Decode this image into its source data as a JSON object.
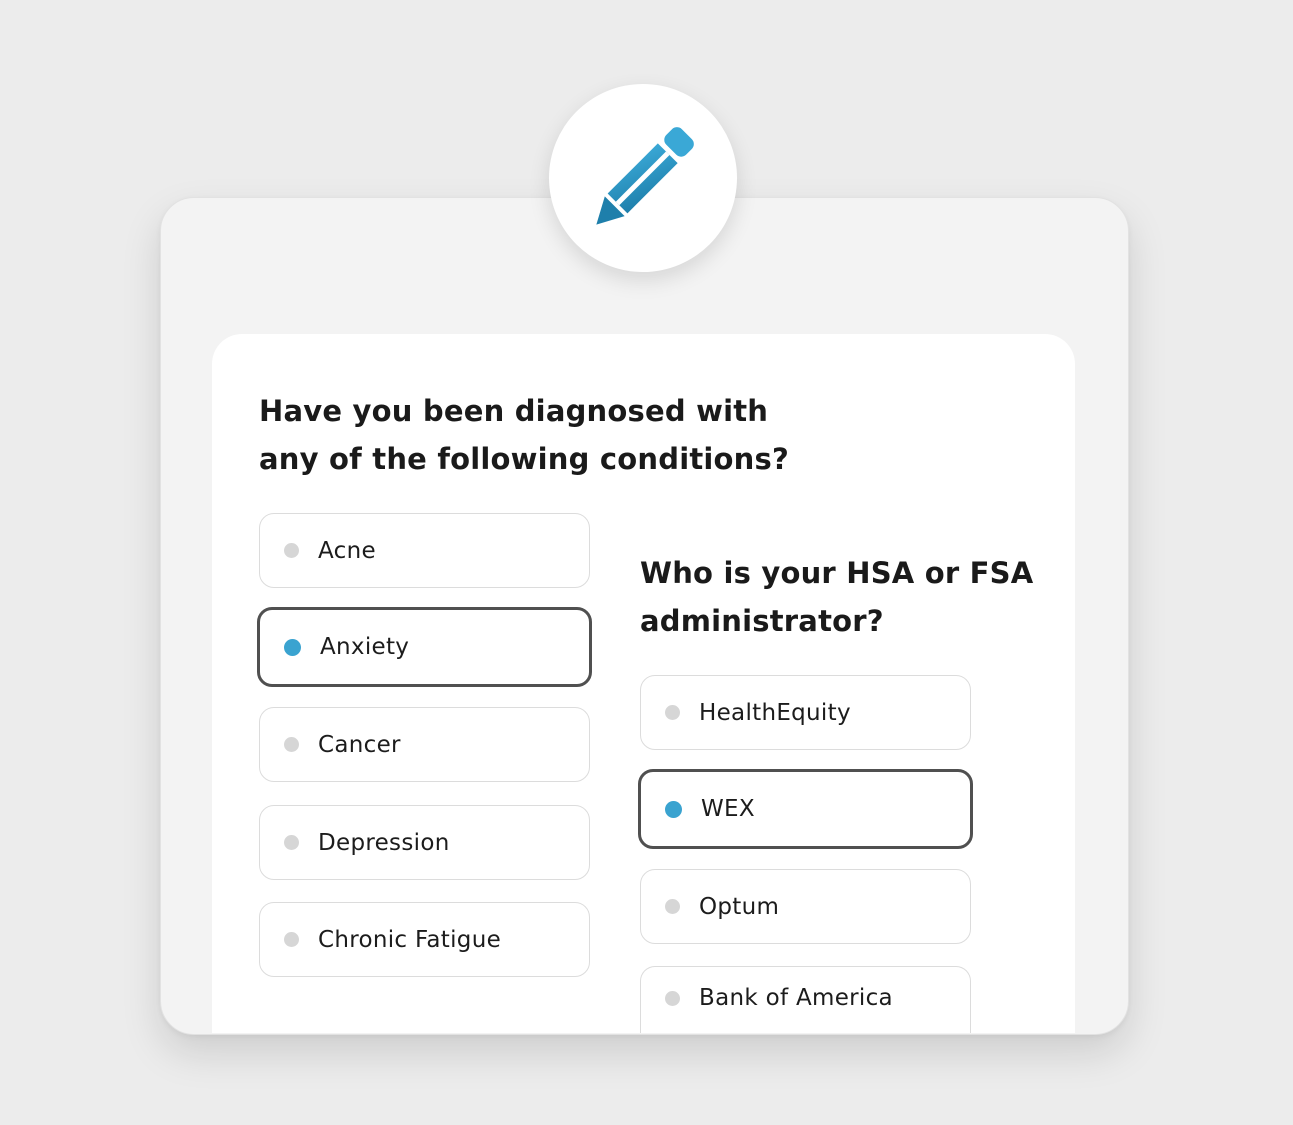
{
  "colors": {
    "accent": "#3aa3d0",
    "pencil_dark": "#1e7fab",
    "unselected_dot": "#d6d6d6",
    "selected_border": "#505050"
  },
  "icon": {
    "name": "pencil-icon"
  },
  "conditions": {
    "question_line1": "Have you been diagnosed with",
    "question_line2": "any of the following conditions?",
    "options": [
      {
        "label": "Acne",
        "selected": false
      },
      {
        "label": "Anxiety",
        "selected": true
      },
      {
        "label": "Cancer",
        "selected": false
      },
      {
        "label": "Depression",
        "selected": false
      },
      {
        "label": "Chronic Fatigue",
        "selected": false
      }
    ]
  },
  "administrator": {
    "question_line1": "Who is your HSA or FSA",
    "question_line2": "administrator?",
    "options": [
      {
        "label": "HealthEquity",
        "selected": false
      },
      {
        "label": "WEX",
        "selected": true
      },
      {
        "label": "Optum",
        "selected": false
      },
      {
        "label": "Bank of America",
        "selected": false
      }
    ]
  }
}
